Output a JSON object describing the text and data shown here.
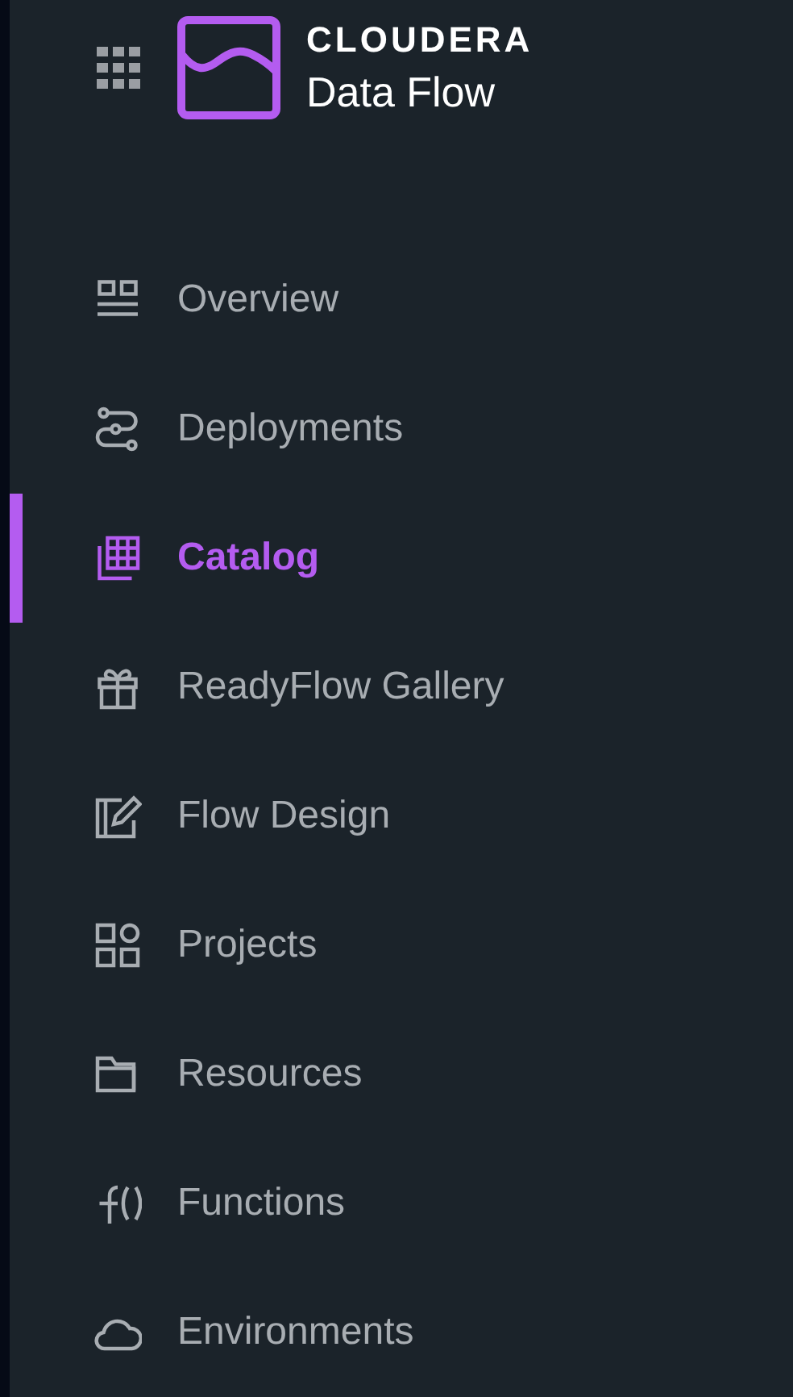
{
  "brand": {
    "company": "CLOUDERA",
    "product": "Data Flow"
  },
  "nav": [
    {
      "label": "Overview",
      "kind": "overview",
      "selected": false
    },
    {
      "label": "Deployments",
      "kind": "deployments",
      "selected": false
    },
    {
      "label": "Catalog",
      "kind": "catalog",
      "selected": true
    },
    {
      "label": "ReadyFlow Gallery",
      "kind": "gallery",
      "selected": false
    },
    {
      "label": "Flow Design",
      "kind": "design",
      "selected": false
    },
    {
      "label": "Projects",
      "kind": "projects",
      "selected": false
    },
    {
      "label": "Resources",
      "kind": "resources",
      "selected": false
    },
    {
      "label": "Functions",
      "kind": "functions",
      "selected": false
    },
    {
      "label": "Environments",
      "kind": "environments",
      "selected": false
    }
  ]
}
